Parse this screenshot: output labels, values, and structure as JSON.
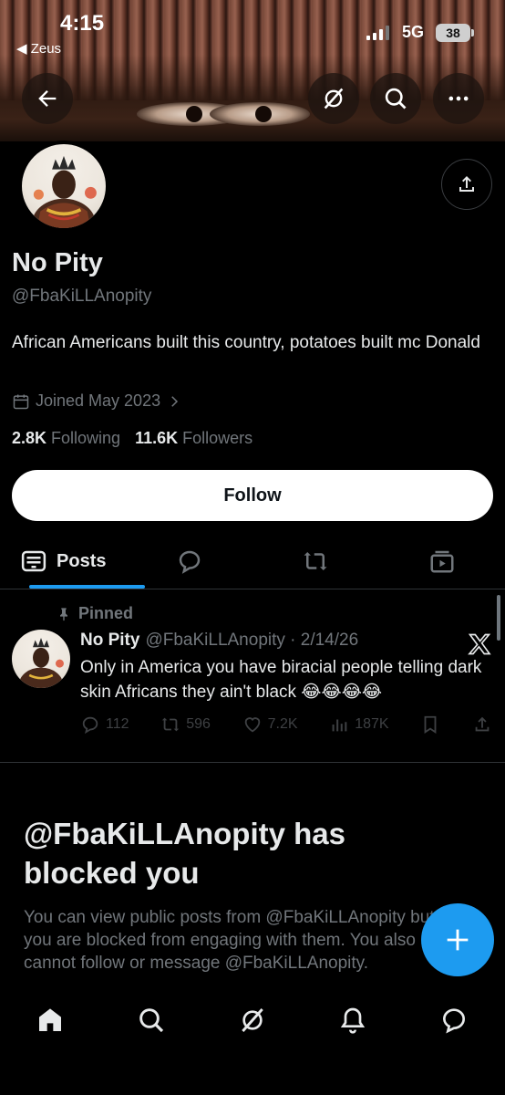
{
  "status_bar": {
    "time": "4:15",
    "back_app": "◀ Zeus",
    "network": "5G",
    "battery": "38"
  },
  "header": {
    "icons": [
      "back-arrow-icon",
      "grok-icon",
      "search-icon",
      "more-icon"
    ]
  },
  "profile": {
    "name": "No Pity",
    "handle": "@FbaKiLLAnopity",
    "bio": "African Americans built this country, potatoes built mc Donald",
    "joined": "Joined May 2023",
    "following_count": "2.8K",
    "following_label": "Following",
    "followers_count": "11.6K",
    "followers_label": "Followers",
    "follow_label": "Follow"
  },
  "tabs": {
    "posts_label": "Posts"
  },
  "pinned_post": {
    "pinned_label": "Pinned",
    "author": "No Pity",
    "meta": "@FbaKiLLAnopity · 2/14/26",
    "text": "Only in America you have biracial people telling dark skin Africans they ain't black 😂😂😂😂",
    "replies": "112",
    "reposts": "596",
    "likes": "7.2K",
    "views": "187K"
  },
  "blocked": {
    "title": "@FbaKiLLAnopity has blocked you",
    "body": "You can view public posts from @FbaKiLLAnopity but you are blocked from engaging with them. You also cannot follow or message @FbaKiLLAnopity."
  },
  "colors": {
    "accent": "#1d9bf0",
    "background": "#000000",
    "text": "#e7e9ea",
    "muted": "#71767b"
  }
}
